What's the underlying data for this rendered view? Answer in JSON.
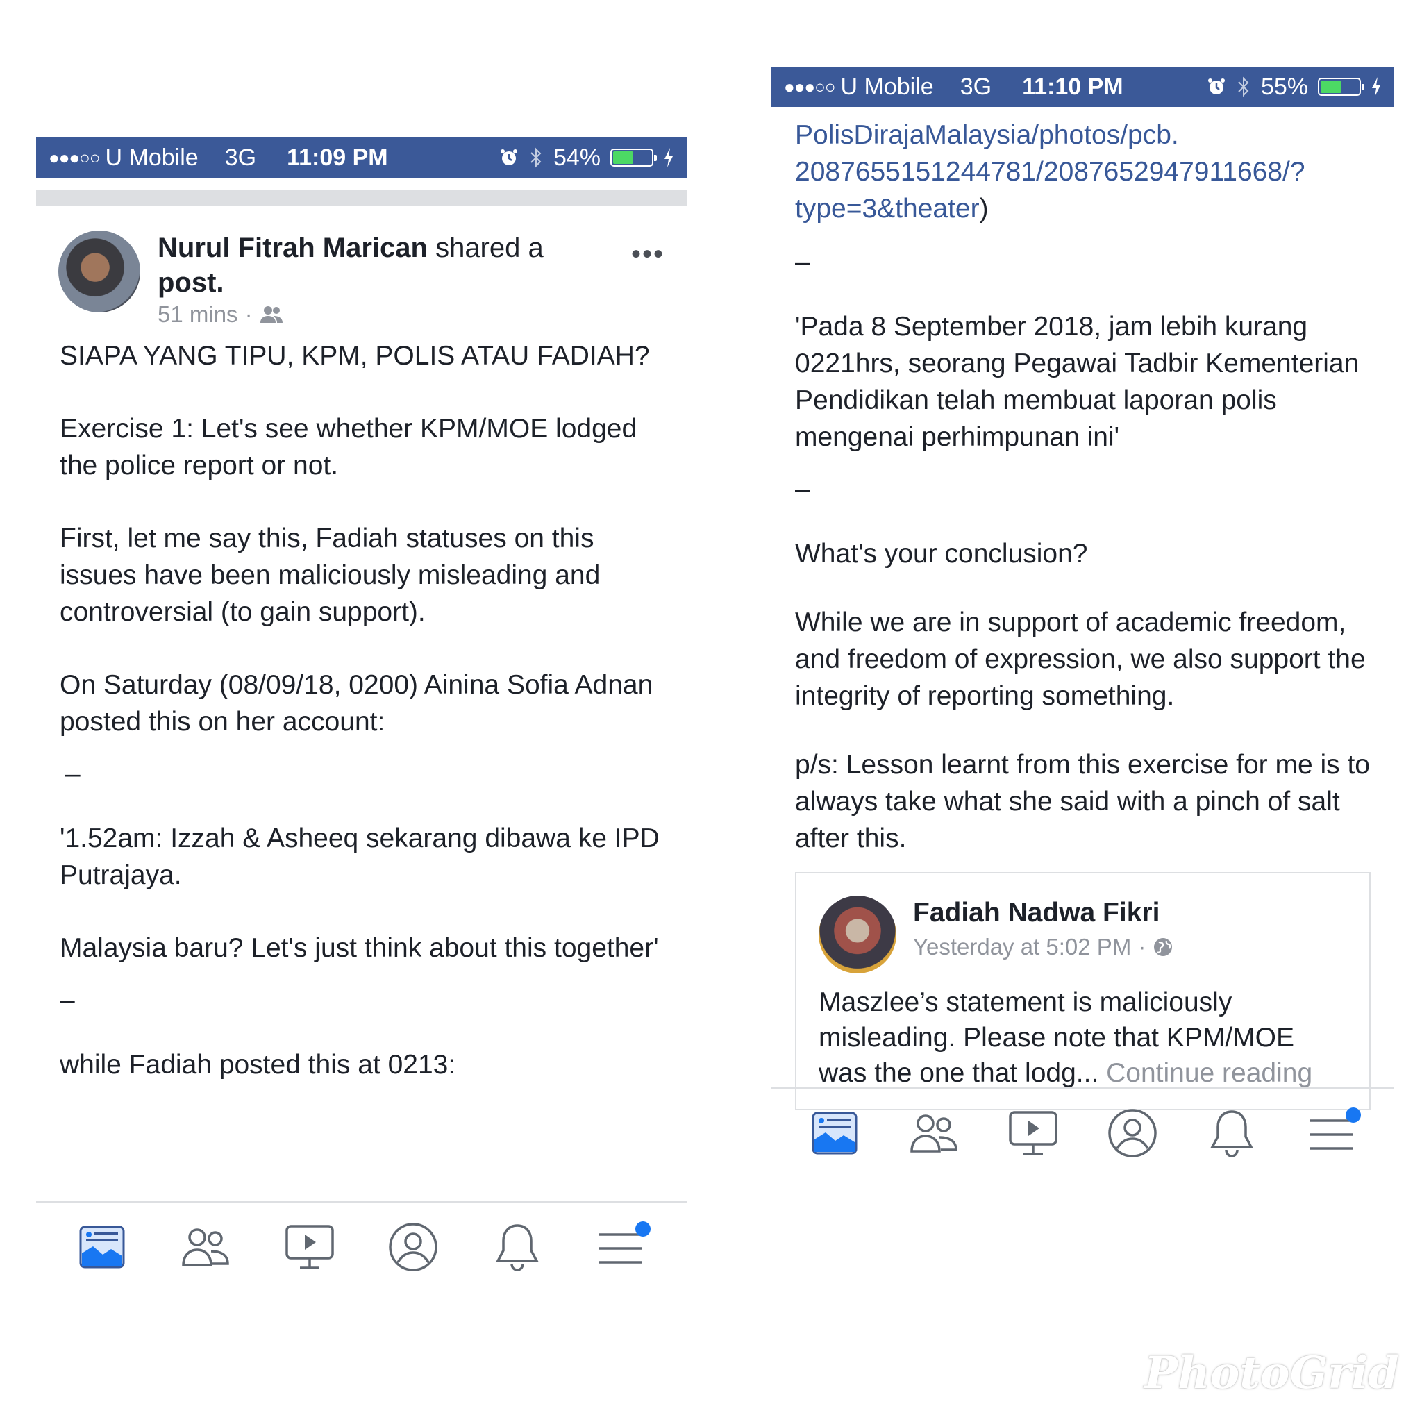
{
  "left": {
    "status": {
      "signal": "●●●○○",
      "carrier": "U Mobile",
      "network": "3G",
      "time": "11:09 PM",
      "battery": "54%",
      "battery_level": 0.54
    },
    "post": {
      "author": "Nurul Fitrah Marican",
      "action": " shared a ",
      "object": "post.",
      "time": "51 mins",
      "privacy_icon": "friends-icon",
      "more": "•••",
      "paragraphs": [
        "SIAPA YANG TIPU, KPM, POLIS ATAU FADIAH?",
        "Exercise 1: Let's see whether KPM/MOE lodged the police report or not.",
        "First, let me say this, Fadiah statuses on this issues have been maliciously misleading and controversial (to gain support).",
        "On Saturday (08/09/18, 0200) Ainina Sofia Adnan posted this on her account:",
        "–",
        "'1.52am: Izzah & Asheeq sekarang dibawa ke IPD Putrajaya.",
        "Malaysia baru? Let's just think about this together'",
        "–",
        "while Fadiah posted this at 0213:"
      ]
    }
  },
  "right": {
    "status": {
      "signal": "●●●○○",
      "carrier": "U Mobile",
      "network": "3G",
      "time": "11:10 PM",
      "battery": "55%",
      "battery_level": 0.55
    },
    "link_lines": [
      "PolisDirajaMalaysia/photos/pcb.",
      "2087655151244781/2087652947911668/?",
      "type=3&theater"
    ],
    "link_close": ")",
    "paragraphs": [
      "–",
      "'Pada 8 September 2018, jam lebih kurang 0221hrs, seorang Pegawai Tadbir Kementerian Pendidikan telah membuat laporan polis mengenai perhimpunan ini'",
      "–",
      "What's your conclusion?",
      "While we are in support of academic freedom, and freedom of expression, we also support the integrity of reporting something.",
      "p/s: Lesson learnt from this exercise for me is to always take what she said with a pinch of salt after this."
    ],
    "shared_card": {
      "author": "Fadiah Nadwa Fikri",
      "time": "Yesterday at 5:02 PM",
      "privacy_icon": "globe-icon",
      "text": "Maszlee’s statement is maliciously misleading. Please note that KPM/MOE was the one that lodg... ",
      "continue": "Continue reading"
    }
  },
  "tabbar": [
    "news-feed-icon",
    "friends-icon",
    "watch-icon",
    "profile-icon",
    "notifications-icon",
    "menu-icon"
  ],
  "colors": {
    "brand": "#3b5998",
    "link": "#385898",
    "battery": "#4cd964",
    "badge": "#1877f2"
  },
  "watermark": "PhotoGrid"
}
